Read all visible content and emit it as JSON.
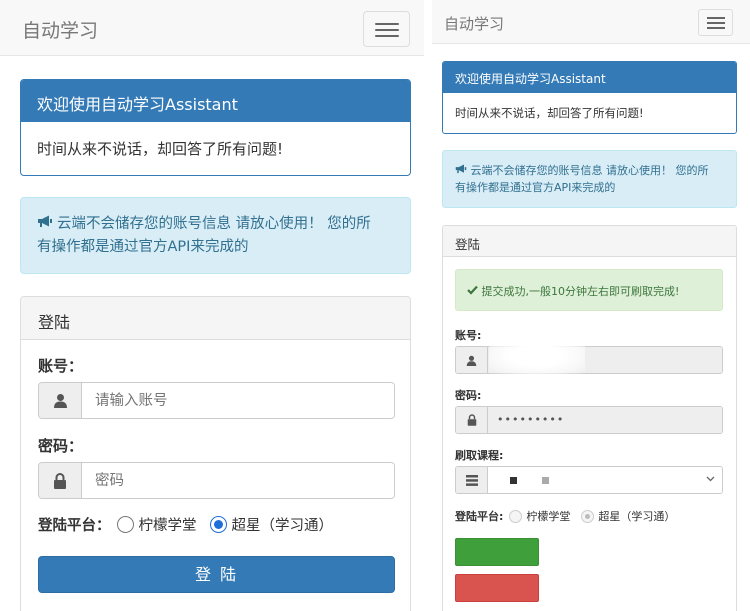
{
  "left": {
    "brand": "自动学习",
    "welcome_title": "欢迎使用自动学习Assistant",
    "welcome_text": "时间从来不说话，却回答了所有问题!",
    "alert_line1": "云端不会储存您的账号信息 请放心使用！ 您的所",
    "alert_line2": "有操作都是通过官方API来完成的",
    "login_title": "登陆",
    "account_label": "账号：",
    "account_placeholder": "请输入账号",
    "password_label": "密码：",
    "password_placeholder": "密码",
    "platform_label": "登陆平台：",
    "platform_options": [
      "柠檬学堂",
      "超星（学习通）"
    ],
    "platform_selected": "超星（学习通）",
    "submit_label": "登 陆"
  },
  "right": {
    "brand": "自动学习",
    "welcome_title": "欢迎使用自动学习Assistant",
    "welcome_text": "时间从来不说话，却回答了所有问题!",
    "alert_line1": "云端不会储存您的账号信息 请放心使用！ 您的所",
    "alert_line2": "有操作都是通过官方API来完成的",
    "login_title": "登陆",
    "success_message": "提交成功,一般10分钟左右即可刷取完成!",
    "account_label": "账号:",
    "password_label": "密码:",
    "password_value": "•••••••••",
    "course_label": "刷取课程:",
    "platform_label": "登陆平台:",
    "platform_options": [
      "柠檬学堂",
      "超星（学习通）"
    ],
    "platform_selected": "超星（学习通）"
  },
  "icons": {
    "megaphone": "megaphone-icon",
    "user": "user-icon",
    "lock": "lock-icon",
    "list": "list-icon",
    "check": "check-icon",
    "menu": "hamburger-menu-icon"
  },
  "colors": {
    "primary": "#337ab7",
    "info_bg": "#d9edf7",
    "info_text": "#31708f",
    "success_bg": "#dff0d8",
    "success_text": "#3c763d",
    "green_button": "#3f9f3b",
    "red_button": "#d9534f",
    "radio_active": "#1e6fd9"
  }
}
